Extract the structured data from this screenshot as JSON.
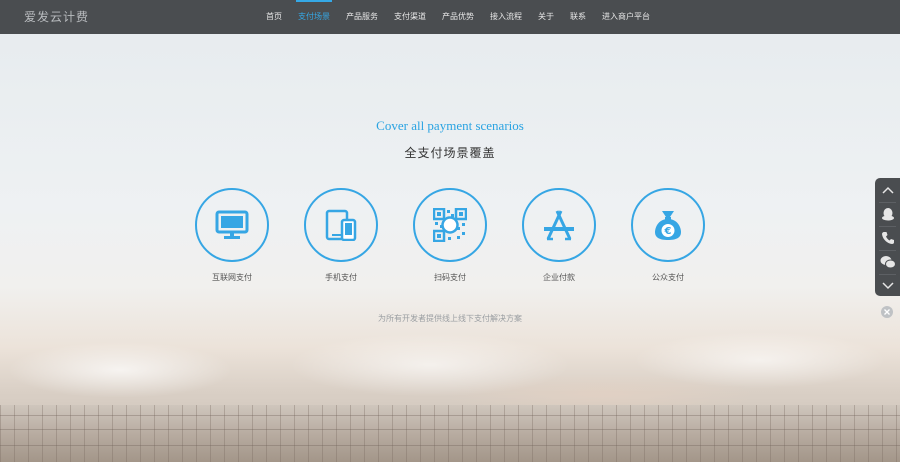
{
  "brand": {
    "logo_text": "爱发云计费"
  },
  "nav": {
    "items": [
      {
        "label": "首页"
      },
      {
        "label": "支付场景"
      },
      {
        "label": "产品服务"
      },
      {
        "label": "支付渠道"
      },
      {
        "label": "产品优势"
      },
      {
        "label": "接入流程"
      },
      {
        "label": "关于"
      },
      {
        "label": "联系"
      },
      {
        "label": "进入商户平台"
      }
    ],
    "active_index": 1
  },
  "hero": {
    "title_en": "Cover all payment scenarios",
    "title_cn": "全支付场景覆盖",
    "features": [
      {
        "label": "互联网支付",
        "icon": "monitor-icon"
      },
      {
        "label": "手机支付",
        "icon": "mobile-tablet-icon"
      },
      {
        "label": "扫码支付",
        "icon": "qr-code-icon"
      },
      {
        "label": "企业付款",
        "icon": "app-store-icon"
      },
      {
        "label": "公众支付",
        "icon": "money-bag-icon"
      }
    ],
    "tagline": "为所有开发者提供线上线下支付解决方案"
  },
  "sidebar_tools": [
    "chevron-up-icon",
    "qq-icon",
    "phone-icon",
    "wechat-icon",
    "chevron-down-icon"
  ],
  "colors": {
    "accent": "#35a8e6",
    "nav_bg": "#4a4d50"
  }
}
